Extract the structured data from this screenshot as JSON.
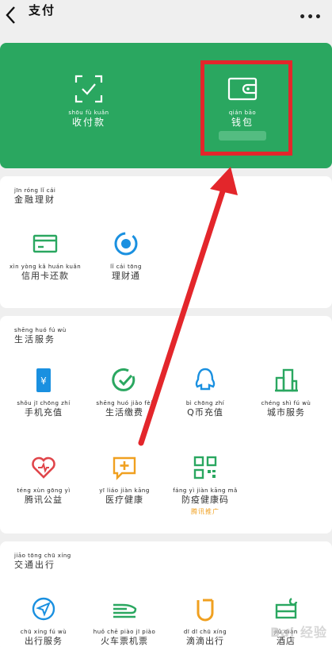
{
  "header": {
    "title_pinyin": "",
    "title": "支付",
    "more": "•••"
  },
  "wallet": {
    "pay": {
      "pinyin": "shōu fù kuǎn",
      "label": "收付款"
    },
    "wallet": {
      "pinyin": "qián bāo",
      "label": "钱包"
    }
  },
  "finance": {
    "title_pinyin": "jīn róng lǐ cái",
    "title": "金融理财",
    "items": [
      {
        "pinyin": "xìn yòng kǎ huán kuǎn",
        "label": "信用卡还款"
      },
      {
        "pinyin": "lǐ cái tōng",
        "label": "理财通"
      }
    ]
  },
  "life": {
    "title_pinyin": "shēng huó fú wù",
    "title": "生活服务",
    "items": [
      {
        "pinyin": "shǒu jī chōng zhí",
        "label": "手机充值"
      },
      {
        "pinyin": "shēng huó jiǎo fèi",
        "label": "生活缴费"
      },
      {
        "pinyin": "bì chōng zhí",
        "label": "Q币充值"
      },
      {
        "pinyin": "chéng shì fú wù",
        "label": "城市服务"
      },
      {
        "pinyin": "téng xùn gōng yì",
        "label": "腾讯公益"
      },
      {
        "pinyin": "yī liáo jiàn kāng",
        "label": "医疗健康"
      },
      {
        "pinyin": "fáng yì jiàn kāng mǎ",
        "label": "防疫健康码",
        "sub": "腾讯推广"
      }
    ]
  },
  "transport": {
    "title_pinyin": "jiāo tōng chū xíng",
    "title": "交通出行",
    "items": [
      {
        "pinyin": "chū xíng fú wù",
        "label": "出行服务"
      },
      {
        "pinyin": "huǒ chē piào jī piào",
        "label": "火车票机票"
      },
      {
        "pinyin": "dī dī chū xíng",
        "label": "滴滴出行"
      },
      {
        "pinyin": "jiǔ diàn",
        "label": "酒店"
      }
    ]
  },
  "watermark": "Bai 经验",
  "colors": {
    "brand_green": "#2aa760",
    "accent_red": "#e3262b",
    "icon_green": "#2aa760",
    "icon_blue": "#1a90e0",
    "icon_orange": "#f0a020"
  }
}
